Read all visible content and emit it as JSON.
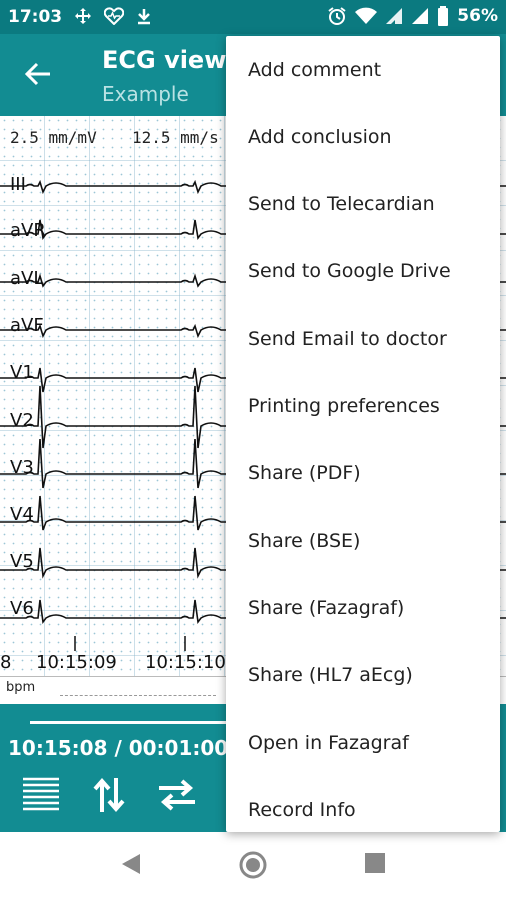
{
  "status_bar": {
    "time": "17:03",
    "battery": "56%",
    "icons_left": [
      "move-icon",
      "heart-rate-icon",
      "download-icon"
    ],
    "icons_right": [
      "alarm-icon",
      "wifi-icon",
      "signal-icon",
      "battery-icon"
    ]
  },
  "app_bar": {
    "title": "ECG view",
    "subtitle": "Example"
  },
  "ecg": {
    "scale_label": "2.5 mm/mV",
    "speed_label": "12.5 mm/s",
    "leads": [
      "III",
      "aVR",
      "aVL",
      "aVF",
      "V1",
      "V2",
      "V3",
      "V4",
      "V5",
      "V6"
    ],
    "time_ticks": [
      "8",
      "10:15:09",
      "10:15:10"
    ],
    "grid_color": "#7fb0c8"
  },
  "bpm_strip": {
    "label": "bpm"
  },
  "playback": {
    "time_readout": "10:15:08 / 00:01:00"
  },
  "toolbar": {
    "icons": [
      "lines-icon",
      "swap-vertical-icon",
      "swap-horizontal-icon",
      "more-icon"
    ]
  },
  "menu": {
    "items": [
      "Add comment",
      "Add conclusion",
      "Send to Telecardian",
      "Send to Google Drive",
      "Send Email to doctor",
      "Printing preferences",
      "Share (PDF)",
      "Share (BSE)",
      "Share (Fazagraf)",
      "Share (HL7 aEcg)",
      "Open in Fazagraf",
      "Record Info"
    ]
  },
  "colors": {
    "status_bar": "#0b7a80",
    "app_bar": "#128c92",
    "accent": "#128c92"
  }
}
